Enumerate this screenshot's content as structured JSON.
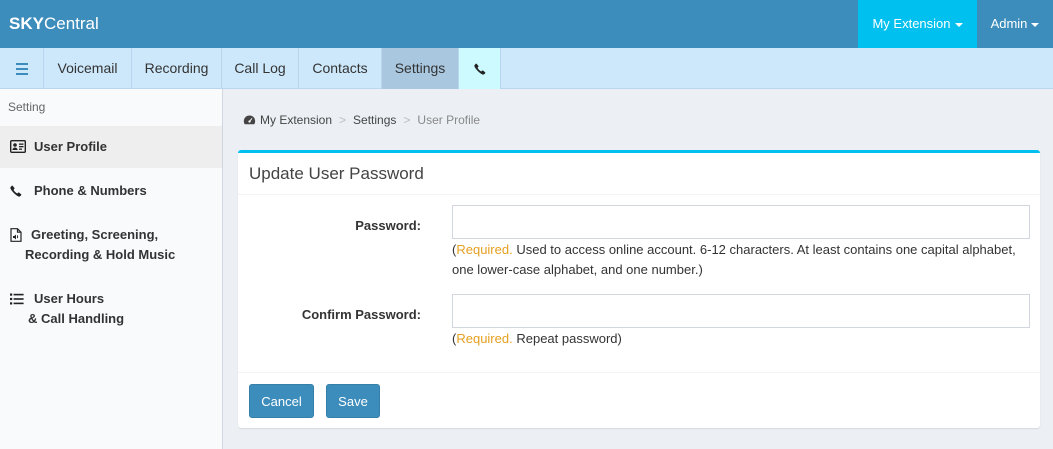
{
  "header": {
    "brand_bold": "SKY",
    "brand_rest": "Central",
    "my_extension": "My Extension",
    "admin": "Admin"
  },
  "tabs": [
    {
      "label": "Voicemail"
    },
    {
      "label": "Recording"
    },
    {
      "label": "Call Log"
    },
    {
      "label": "Contacts"
    },
    {
      "label": "Settings",
      "active": true
    }
  ],
  "sidebar": {
    "heading": "Setting",
    "items": [
      {
        "label": "User Profile",
        "icon": "id-card-icon",
        "active": true
      },
      {
        "label": "Phone & Numbers",
        "icon": "phone-icon"
      },
      {
        "label_line1": "Greeting, Screening,",
        "label_line2": "Recording & Hold Music",
        "icon": "audio-file-icon"
      },
      {
        "label_line1": "User Hours",
        "label_line2": "& Call Handling",
        "icon": "list-icon"
      }
    ]
  },
  "breadcrumb": {
    "home": "My Extension",
    "section": "Settings",
    "current": "User Profile"
  },
  "form": {
    "title": "Update User Password",
    "password_label": "Password:",
    "password_value": "",
    "password_help_required": "Required.",
    "password_help_text": "Used to access online account. 6-12 characters. At least contains one capital alphabet, one lower-case alphabet, and one number.)",
    "confirm_label": "Confirm Password:",
    "confirm_value": "",
    "confirm_help_required": "Required.",
    "confirm_help_text": "Repeat password)",
    "cancel_label": "Cancel",
    "save_label": "Save"
  },
  "colors": {
    "header": "#3c8dbc",
    "accent": "#00c0ef",
    "tabbar": "#cde8fb",
    "required": "#e6a020"
  }
}
